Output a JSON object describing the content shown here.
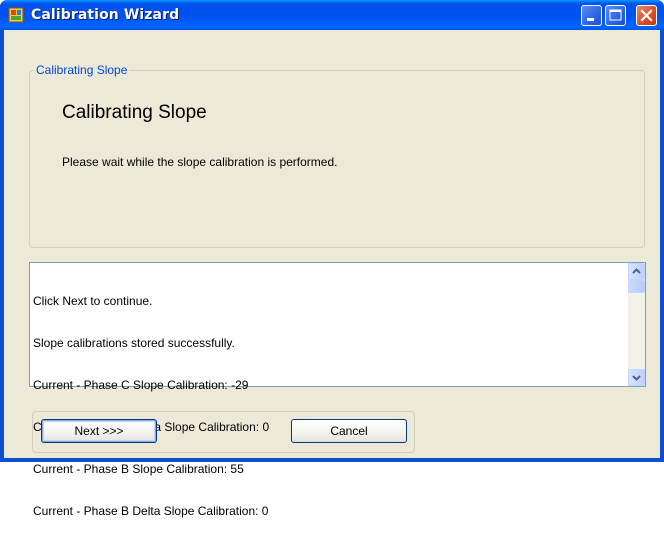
{
  "window": {
    "title": "Calibration Wizard",
    "icon": "wizard-app-icon",
    "controls": [
      "minimize-icon",
      "maximize-icon",
      "close-icon"
    ]
  },
  "group": {
    "legend": "Calibrating Slope",
    "heading": "Calibrating Slope",
    "description": "Please wait while the slope calibration is performed."
  },
  "log": {
    "lines": [
      "Click Next to continue.",
      "Slope calibrations stored successfully.",
      "Current - Phase C Slope Calibration: -29",
      "Current - Phase C Delta Slope Calibration: 0",
      "Current - Phase B Slope Calibration: 55",
      "Current - Phase B Delta Slope Calibration: 0"
    ]
  },
  "buttons": {
    "next": "Next >>>",
    "cancel": "Cancel"
  },
  "colors": {
    "titlebar": "#0053ee",
    "face": "#ece9d8",
    "legend_text": "#0046d5"
  }
}
